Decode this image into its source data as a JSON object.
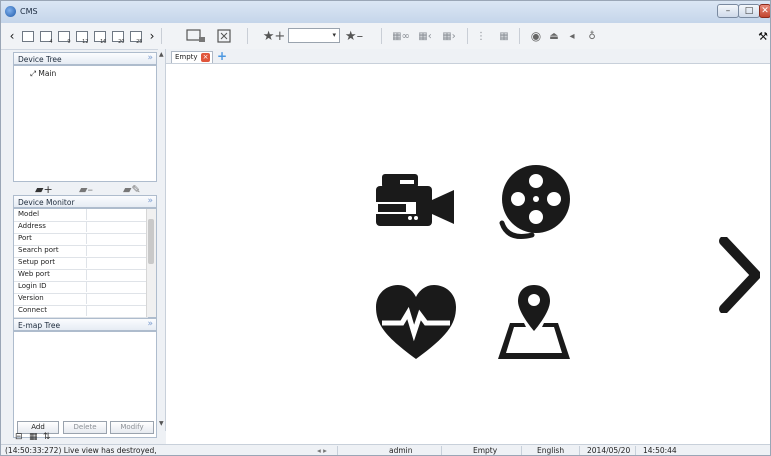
{
  "window": {
    "title": "CMS",
    "controls": {
      "minimize": "–",
      "maximize": "□",
      "close": "✕"
    }
  },
  "toolbar": {
    "layout_buttons": [
      {
        "name": "1",
        "label": ""
      },
      {
        "name": "4",
        "label": "4"
      },
      {
        "name": "9",
        "label": "9"
      },
      {
        "name": "12",
        "label": "12"
      },
      {
        "name": "16",
        "label": "16"
      },
      {
        "name": "20",
        "label": "20"
      },
      {
        "name": "25",
        "label": "25"
      }
    ],
    "preset_dropdown_value": ""
  },
  "left_panel": {
    "device_tree": {
      "title": "Device Tree",
      "items": [
        {
          "label": "Main"
        }
      ]
    },
    "device_monitor": {
      "title": "Device Monitor",
      "rows": [
        {
          "key": "Model",
          "value": ""
        },
        {
          "key": "Address",
          "value": ""
        },
        {
          "key": "Port",
          "value": ""
        },
        {
          "key": "Search port",
          "value": ""
        },
        {
          "key": "Setup port",
          "value": ""
        },
        {
          "key": "Web port",
          "value": ""
        },
        {
          "key": "Login ID",
          "value": ""
        },
        {
          "key": "Version",
          "value": ""
        },
        {
          "key": "Connect",
          "value": ""
        }
      ]
    },
    "emap_tree": {
      "title": "E-map Tree",
      "buttons": {
        "add": "Add",
        "delete": "Delete",
        "modify": "Modify"
      }
    }
  },
  "main": {
    "tabs": [
      {
        "label": "Empty"
      }
    ],
    "feature_icons": [
      "camcorder-icon",
      "film-reel-icon",
      "heartbeat-icon",
      "map-pin-icon"
    ]
  },
  "statusbar": {
    "log": "(14:50:33:272)  Live view has destroyed,",
    "user": "admin",
    "layout": "Empty",
    "language": "English",
    "date": "2014/05/20",
    "time": "14:50:44"
  },
  "colors": {
    "icon": "#1a1a1a",
    "accent": "#4b97e0",
    "tab_close": "#e0553b"
  }
}
